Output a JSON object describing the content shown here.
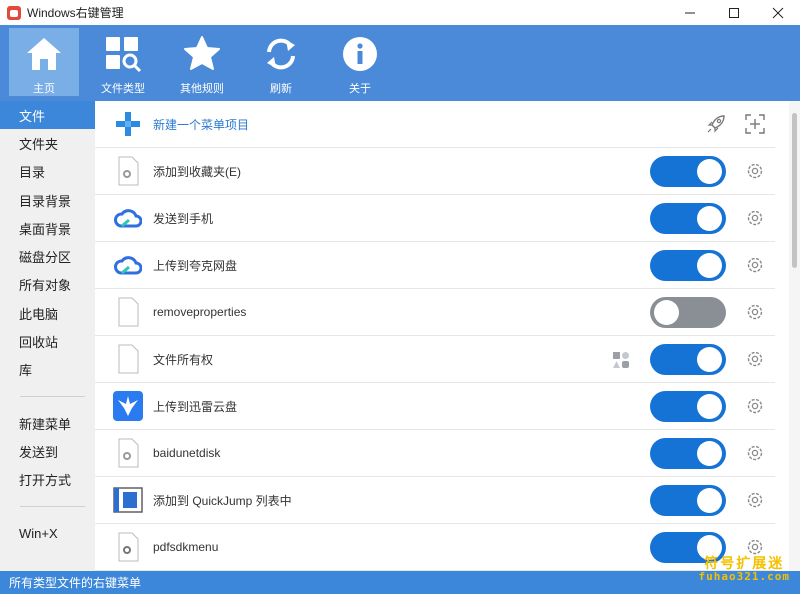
{
  "window": {
    "title": "Windows右键管理",
    "minimize_icon": "minimize-icon",
    "maximize_icon": "maximize-icon",
    "close_icon": "close-icon"
  },
  "toolbar": {
    "items": [
      {
        "label": "主页",
        "icon": "home-icon",
        "active": true
      },
      {
        "label": "文件类型",
        "icon": "file-type-icon"
      },
      {
        "label": "其他规则",
        "icon": "star-icon"
      },
      {
        "label": "刷新",
        "icon": "refresh-icon"
      },
      {
        "label": "关于",
        "icon": "info-icon"
      }
    ]
  },
  "sidebar": {
    "group1": [
      "文件",
      "文件夹",
      "目录",
      "目录背景",
      "桌面背景",
      "磁盘分区",
      "所有对象",
      "此电脑",
      "回收站",
      "库"
    ],
    "group2": [
      "新建菜单",
      "发送到",
      "打开方式"
    ],
    "group3": [
      "Win+X"
    ],
    "active": "文件"
  },
  "main": {
    "new_item": {
      "label": "新建一个菜单项目",
      "icons": [
        "rocket-icon",
        "add-target-icon"
      ]
    },
    "items": [
      {
        "label": "添加到收藏夹(E)",
        "icon": "gear-file-icon",
        "enabled": true
      },
      {
        "label": "发送到手机",
        "icon": "cloud-icon",
        "enabled": true
      },
      {
        "label": "上传到夸克网盘",
        "icon": "cloud-icon",
        "enabled": true
      },
      {
        "label": "removeproperties",
        "icon": "blank-file-icon",
        "enabled": false
      },
      {
        "label": "文件所有权",
        "icon": "blank-file-icon",
        "enabled": true,
        "extra_icon": "shapes-icon"
      },
      {
        "label": "上传到迅雷云盘",
        "icon": "thunder-bird-icon",
        "enabled": true
      },
      {
        "label": "baidunetdisk",
        "icon": "gear-file-icon",
        "enabled": true
      },
      {
        "label": "添加到 QuickJump 列表中",
        "icon": "quickjump-icon",
        "enabled": true
      },
      {
        "label": "pdfsdkmenu",
        "icon": "gear-file-icon",
        "enabled": true
      }
    ]
  },
  "status": {
    "text": "所有类型文件的右键菜单"
  },
  "watermark": {
    "line1": "符号扩展迷",
    "line2": "fuhao321.com"
  },
  "colors": {
    "toolbar": "#4a8ad8",
    "accent": "#1673d6",
    "toggle_off": "#8a8f96",
    "sidebar_active": "#3c87d9"
  }
}
